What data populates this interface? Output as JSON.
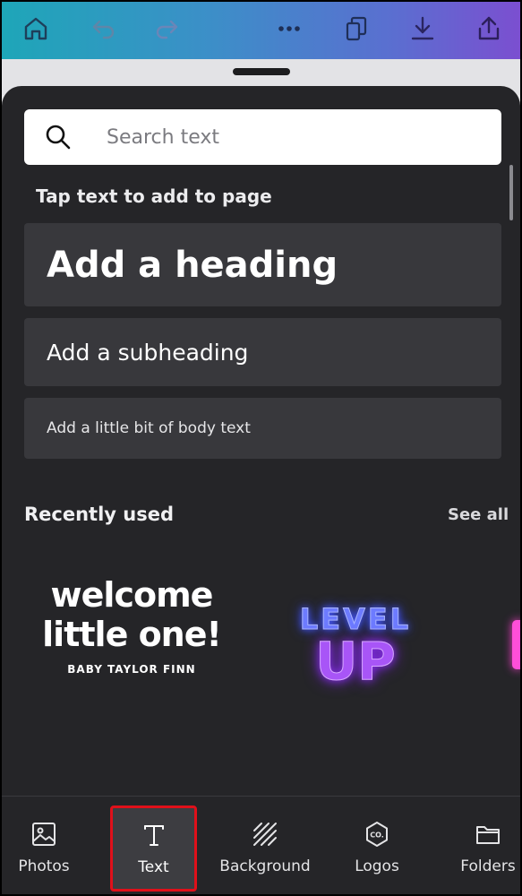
{
  "toolbar": {
    "icons": [
      "home-icon",
      "undo-icon",
      "redo-icon",
      "more-icon",
      "pages-icon",
      "download-icon",
      "share-icon"
    ]
  },
  "search": {
    "placeholder": "Search text"
  },
  "text_panel": {
    "tap_label": "Tap text to add to page",
    "heading": "Add a heading",
    "subheading": "Add a subheading",
    "body": "Add a little bit of body text"
  },
  "recently_used": {
    "label": "Recently used",
    "see_all": "See all",
    "templates": [
      {
        "lines": [
          "welcome",
          "little one!",
          "BABY TAYLOR FINN"
        ]
      },
      {
        "lines": [
          "LEVEL",
          "UP"
        ]
      }
    ]
  },
  "bottom_nav": {
    "items": [
      {
        "label": "Photos",
        "icon": "photos-icon"
      },
      {
        "label": "Text",
        "icon": "text-icon",
        "selected": true
      },
      {
        "label": "Background",
        "icon": "background-icon"
      },
      {
        "label": "Logos",
        "icon": "logos-icon"
      },
      {
        "label": "Folders",
        "icon": "folders-icon"
      }
    ]
  },
  "colors": {
    "panel_bg": "#252528",
    "card_bg": "#38383c",
    "highlight_border": "#e0101a",
    "toolbar_gradient_start": "#1ea6b8",
    "toolbar_gradient_end": "#7b4fd0"
  }
}
